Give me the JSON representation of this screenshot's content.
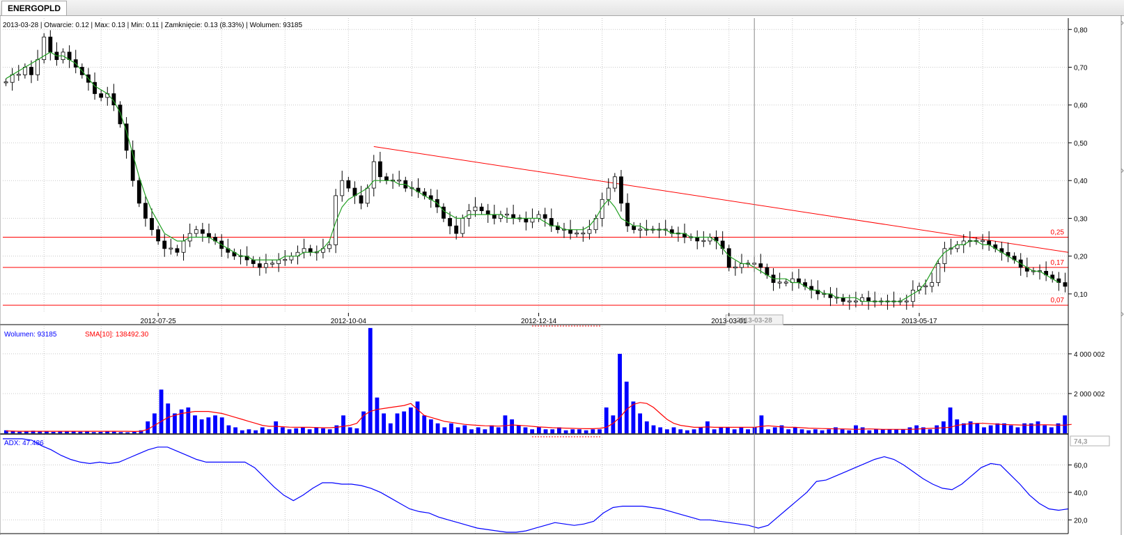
{
  "tab": {
    "label": "ENERGOPLD"
  },
  "info": {
    "text": "2013-03-28 | Otwarcie: 0.12 | Max: 0.13 | Min: 0.11 | Zamknięcie: 0.13 (8.33%) | Wolumen: 93185",
    "volume_legend": "Wolumen: 93185",
    "sma_legend": "SMA[10]: 138492.30",
    "adx_legend": "ADX: 47.486"
  },
  "colors": {
    "up_candle": "#ffffff",
    "down_candle": "#000000",
    "sma_price": "#22a022",
    "trend_line": "#ff0000",
    "volume_bar": "#0000ff",
    "volume_sma": "#ff0000",
    "adx_line": "#0000ff",
    "grid": "#c8c8c8"
  },
  "chart_data": [
    {
      "type": "candlestick",
      "panel": "price",
      "x_labels": [
        "2012-07-25",
        "2012-10-04",
        "2012-12-14",
        "2013-03-01",
        "2013-05-17"
      ],
      "cursor_label": "2013-03-28",
      "y_ticks": [
        "0,80",
        "0,70",
        "0,60",
        "0,50",
        "0,40",
        "0,30",
        "0,20",
        "0,10"
      ],
      "ylim": [
        0.05,
        0.83
      ],
      "horizontal_levels": [
        {
          "value": 0.25,
          "label": "0,25"
        },
        {
          "value": 0.17,
          "label": "0,17"
        },
        {
          "value": 0.07,
          "label": "0,07"
        }
      ],
      "trend_line": {
        "from_value": 0.49,
        "to_value": 0.21
      },
      "close_path": [
        0.66,
        0.68,
        0.68,
        0.7,
        0.68,
        0.72,
        0.78,
        0.74,
        0.72,
        0.74,
        0.72,
        0.7,
        0.68,
        0.66,
        0.63,
        0.62,
        0.63,
        0.6,
        0.55,
        0.48,
        0.4,
        0.34,
        0.3,
        0.27,
        0.24,
        0.22,
        0.22,
        0.21,
        0.24,
        0.26,
        0.27,
        0.26,
        0.25,
        0.24,
        0.22,
        0.21,
        0.2,
        0.2,
        0.19,
        0.18,
        0.17,
        0.18,
        0.18,
        0.19,
        0.19,
        0.2,
        0.21,
        0.22,
        0.21,
        0.21,
        0.22,
        0.23,
        0.36,
        0.4,
        0.38,
        0.36,
        0.34,
        0.38,
        0.45,
        0.41,
        0.4,
        0.4,
        0.4,
        0.38,
        0.38,
        0.37,
        0.36,
        0.35,
        0.33,
        0.3,
        0.28,
        0.26,
        0.3,
        0.32,
        0.33,
        0.32,
        0.31,
        0.3,
        0.31,
        0.31,
        0.3,
        0.3,
        0.29,
        0.3,
        0.31,
        0.3,
        0.28,
        0.27,
        0.27,
        0.26,
        0.26,
        0.26,
        0.27,
        0.3,
        0.35,
        0.38,
        0.41,
        0.34,
        0.28,
        0.27,
        0.27,
        0.27,
        0.27,
        0.27,
        0.27,
        0.26,
        0.26,
        0.25,
        0.25,
        0.24,
        0.24,
        0.25,
        0.24,
        0.22,
        0.17,
        0.17,
        0.18,
        0.18,
        0.18,
        0.17,
        0.15,
        0.13,
        0.13,
        0.13,
        0.14,
        0.13,
        0.12,
        0.11,
        0.1,
        0.1,
        0.09,
        0.09,
        0.08,
        0.08,
        0.08,
        0.09,
        0.08,
        0.08,
        0.08,
        0.08,
        0.08,
        0.08,
        0.08,
        0.11,
        0.12,
        0.12,
        0.13,
        0.18,
        0.22,
        0.22,
        0.23,
        0.24,
        0.24,
        0.24,
        0.24,
        0.23,
        0.22,
        0.21,
        0.2,
        0.19,
        0.17,
        0.16,
        0.16,
        0.16,
        0.15,
        0.14,
        0.13,
        0.12
      ],
      "sma_path": [
        0.67,
        0.68,
        0.69,
        0.7,
        0.71,
        0.72,
        0.73,
        0.74,
        0.73,
        0.73,
        0.72,
        0.71,
        0.69,
        0.67,
        0.65,
        0.64,
        0.63,
        0.61,
        0.58,
        0.53,
        0.47,
        0.41,
        0.36,
        0.32,
        0.29,
        0.26,
        0.25,
        0.24,
        0.24,
        0.25,
        0.25,
        0.25,
        0.25,
        0.24,
        0.23,
        0.22,
        0.21,
        0.2,
        0.2,
        0.19,
        0.19,
        0.19,
        0.19,
        0.19,
        0.2,
        0.2,
        0.2,
        0.21,
        0.21,
        0.21,
        0.22,
        0.24,
        0.29,
        0.33,
        0.35,
        0.36,
        0.37,
        0.38,
        0.4,
        0.4,
        0.4,
        0.4,
        0.39,
        0.39,
        0.38,
        0.37,
        0.36,
        0.35,
        0.34,
        0.32,
        0.31,
        0.3,
        0.3,
        0.31,
        0.31,
        0.31,
        0.31,
        0.31,
        0.31,
        0.3,
        0.3,
        0.3,
        0.3,
        0.3,
        0.3,
        0.29,
        0.28,
        0.28,
        0.27,
        0.27,
        0.27,
        0.27,
        0.28,
        0.3,
        0.33,
        0.35,
        0.33,
        0.3,
        0.29,
        0.28,
        0.28,
        0.27,
        0.27,
        0.27,
        0.27,
        0.26,
        0.26,
        0.26,
        0.25,
        0.25,
        0.25,
        0.25,
        0.24,
        0.22,
        0.2,
        0.19,
        0.18,
        0.18,
        0.17,
        0.16,
        0.15,
        0.14,
        0.14,
        0.14,
        0.13,
        0.13,
        0.12,
        0.11,
        0.11,
        0.1,
        0.1,
        0.09,
        0.09,
        0.09,
        0.09,
        0.08,
        0.08,
        0.08,
        0.08,
        0.08,
        0.08,
        0.08,
        0.09,
        0.1,
        0.11,
        0.13,
        0.16,
        0.19,
        0.21,
        0.22,
        0.23,
        0.23,
        0.24,
        0.24,
        0.23,
        0.23,
        0.22,
        0.21,
        0.2,
        0.19,
        0.18,
        0.17,
        0.16,
        0.16,
        0.15,
        0.14,
        0.13
      ]
    },
    {
      "type": "bar",
      "panel": "volume",
      "y_ticks": [
        "4 000 002",
        "2 000 002"
      ],
      "ylim": [
        0,
        5400000
      ],
      "values": [
        150000,
        120000,
        80000,
        100000,
        130000,
        90000,
        110000,
        70000,
        100000,
        120000,
        90000,
        80000,
        100000,
        60000,
        70000,
        90000,
        80000,
        60000,
        50000,
        70000,
        150000,
        600000,
        1000000,
        2200000,
        1500000,
        1000000,
        1200000,
        1300000,
        900000,
        700000,
        800000,
        900000,
        800000,
        400000,
        300000,
        150000,
        200000,
        150000,
        300000,
        200000,
        600000,
        300000,
        200000,
        250000,
        300000,
        200000,
        300000,
        250000,
        200000,
        400000,
        900000,
        300000,
        250000,
        1100000,
        5300000,
        1800000,
        1000000,
        500000,
        1000000,
        1100000,
        1300000,
        1600000,
        900000,
        700000,
        500000,
        300000,
        500000,
        300000,
        400000,
        200000,
        300000,
        200000,
        400000,
        300000,
        900000,
        700000,
        400000,
        300000,
        200000,
        300000,
        200000,
        200000,
        300000,
        150000,
        200000,
        200000,
        150000,
        200000,
        200000,
        1300000,
        900000,
        4000000,
        2600000,
        1600000,
        1000000,
        600000,
        400000,
        300000,
        200000,
        300000,
        200000,
        150000,
        200000,
        300000,
        600000,
        200000,
        300000,
        300000,
        200000,
        300000,
        200000,
        300000,
        900000,
        200000,
        300000,
        400000,
        200000,
        300000,
        200000,
        150000,
        200000,
        150000,
        200000,
        300000,
        200000,
        150000,
        400000,
        300000,
        150000,
        200000,
        200000,
        200000,
        200000,
        200000,
        300000,
        400000,
        300000,
        200000,
        400000,
        600000,
        1300000,
        700000,
        500000,
        600000,
        500000,
        300000,
        400000,
        500000,
        500000,
        400000,
        300000,
        500000,
        500000,
        600000,
        400000,
        300000,
        500000,
        900000
      ],
      "sma_path": [
        120000,
        110000,
        100000,
        100000,
        100000,
        100000,
        100000,
        100000,
        100000,
        100000,
        100000,
        100000,
        100000,
        100000,
        100000,
        100000,
        100000,
        100000,
        100000,
        90000,
        100000,
        200000,
        400000,
        600000,
        800000,
        900000,
        1000000,
        1050000,
        1100000,
        1100000,
        1100000,
        1050000,
        1000000,
        900000,
        800000,
        700000,
        600000,
        500000,
        400000,
        350000,
        350000,
        330000,
        310000,
        300000,
        300000,
        300000,
        290000,
        280000,
        280000,
        300000,
        350000,
        400000,
        500000,
        900000,
        1100000,
        1200000,
        1250000,
        1300000,
        1350000,
        1400000,
        1500000,
        1200000,
        900000,
        800000,
        700000,
        600000,
        550000,
        500000,
        450000,
        420000,
        400000,
        380000,
        370000,
        360000,
        380000,
        420000,
        400000,
        380000,
        350000,
        320000,
        300000,
        280000,
        270000,
        260000,
        250000,
        240000,
        230000,
        230000,
        250000,
        300000,
        500000,
        800000,
        1200000,
        1450000,
        1550000,
        1500000,
        1300000,
        1000000,
        700000,
        500000,
        400000,
        350000,
        300000,
        300000,
        320000,
        300000,
        300000,
        300000,
        300000,
        300000,
        300000,
        300000,
        350000,
        380000,
        350000,
        320000,
        300000,
        300000,
        280000,
        260000,
        250000,
        240000,
        230000,
        220000,
        220000,
        210000,
        200000,
        210000,
        220000,
        210000,
        200000,
        200000,
        200000,
        200000,
        200000,
        210000,
        230000,
        250000,
        260000,
        280000,
        300000,
        400000,
        450000,
        480000,
        500000,
        500000,
        480000,
        460000,
        440000,
        430000,
        420000,
        410000,
        410000,
        420000,
        430000,
        420000,
        410000,
        410000,
        450000
      ]
    },
    {
      "type": "line",
      "panel": "adx",
      "y_ticks": [
        "60,0",
        "40,0",
        "20,0"
      ],
      "current_value_label": "74,3",
      "ylim": [
        10,
        82
      ],
      "values": [
        79,
        79,
        79,
        78,
        74,
        71,
        67,
        64,
        62,
        61,
        62,
        61,
        62,
        65,
        68,
        71,
        73,
        73,
        70,
        67,
        64,
        62,
        62,
        62,
        62,
        62,
        58,
        51,
        44,
        38,
        34,
        38,
        43,
        47,
        47,
        46,
        46,
        45,
        43,
        40,
        36,
        32,
        28,
        26,
        25,
        22,
        20,
        18,
        16,
        14,
        13,
        12,
        11,
        11,
        12,
        14,
        16,
        18,
        17,
        16,
        17,
        19,
        25,
        29,
        30,
        30,
        30,
        29,
        28,
        26,
        24,
        22,
        20,
        20,
        19,
        18,
        17,
        16,
        14,
        16,
        22,
        28,
        34,
        40,
        48,
        49,
        52,
        55,
        58,
        61,
        64,
        66,
        64,
        60,
        55,
        50,
        46,
        43,
        42,
        46,
        52,
        58,
        61,
        60,
        53,
        46,
        38,
        32,
        28,
        27,
        28
      ]
    }
  ]
}
